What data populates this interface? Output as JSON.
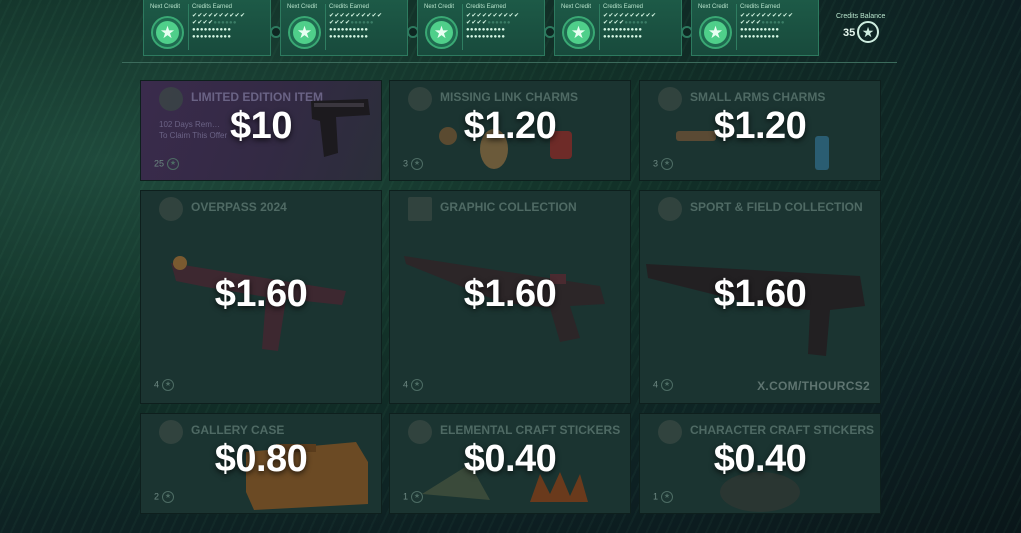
{
  "credit_cards": [
    {
      "next_label": "Next Credit",
      "earned_label": "Credits Earned",
      "ticks_row1": "✔✔✔✔✔✔✔✔✔✔",
      "ticks_row2": "✔✔✔✔",
      "dots_row2": "●●●●●●",
      "dots_row3": "●●●●●●●●●●",
      "dots_row4": "●●●●●●●●●●"
    },
    {
      "next_label": "Next Credit",
      "earned_label": "Credits Earned",
      "ticks_row1": "✔✔✔✔✔✔✔✔✔✔",
      "ticks_row2": "✔✔✔✔",
      "dots_row2": "●●●●●●",
      "dots_row3": "●●●●●●●●●●",
      "dots_row4": "●●●●●●●●●●"
    },
    {
      "next_label": "Next Credit",
      "earned_label": "Credits Earned",
      "ticks_row1": "✔✔✔✔✔✔✔✔✔✔",
      "ticks_row2": "✔✔✔✔",
      "dots_row2": "●●●●●●",
      "dots_row3": "●●●●●●●●●●",
      "dots_row4": "●●●●●●●●●●"
    },
    {
      "next_label": "Next Credit",
      "earned_label": "Credits Earned",
      "ticks_row1": "✔✔✔✔✔✔✔✔✔✔",
      "ticks_row2": "✔✔✔✔",
      "dots_row2": "●●●●●●",
      "dots_row3": "●●●●●●●●●●",
      "dots_row4": "●●●●●●●●●●"
    },
    {
      "next_label": "Next Credit",
      "earned_label": "Credits Earned",
      "ticks_row1": "✔✔✔✔✔✔✔✔✔✔",
      "ticks_row2": "✔✔✔✔",
      "dots_row2": "●●●●●●",
      "dots_row3": "●●●●●●●●●●",
      "dots_row4": "●●●●●●●●●●"
    }
  ],
  "balance": {
    "label": "Credits Balance",
    "value": "35",
    "icon": "star-coin-icon"
  },
  "items": [
    {
      "title": "Limited Edition Item",
      "price": "$10",
      "count": "25",
      "note_line1": "102 Days Rem…",
      "note_line2": "To Claim This Offer"
    },
    {
      "title": "Missing Link Charms",
      "price": "$1.20",
      "count": "3"
    },
    {
      "title": "Small Arms Charms",
      "price": "$1.20",
      "count": "3"
    },
    {
      "title": "Overpass 2024",
      "price": "$1.60",
      "count": "4"
    },
    {
      "title": "Graphic Collection",
      "price": "$1.60",
      "count": "4"
    },
    {
      "title": "Sport & Field Collection",
      "price": "$1.60",
      "count": "4"
    },
    {
      "title": "Gallery Case",
      "price": "$0.80",
      "count": "2"
    },
    {
      "title": "Elemental Craft Stickers",
      "price": "$0.40",
      "count": "1"
    },
    {
      "title": "Character Craft Stickers",
      "price": "$0.40",
      "count": "1"
    }
  ],
  "watermark": "X.COM/THOURCS2",
  "colors": {
    "accent": "#4fcf8a",
    "card_bg": "#1d5a47",
    "tile_bg": "#1b3431"
  }
}
